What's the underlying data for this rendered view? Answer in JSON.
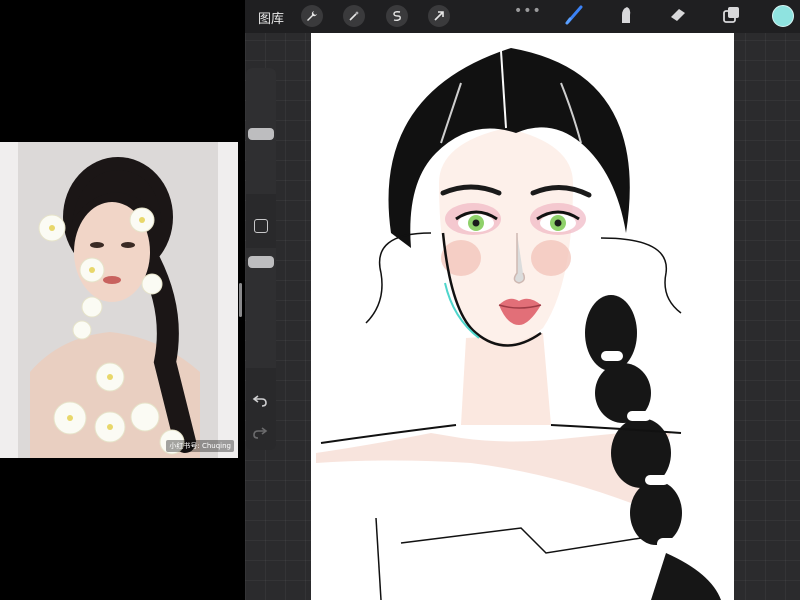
{
  "toolbar": {
    "gallery_label": "图库",
    "more_label": "•••",
    "tools": [
      "wrench-icon",
      "magic-wand-icon",
      "selection-icon",
      "transform-arrow-icon"
    ],
    "right_tools": [
      "brush-icon",
      "smudge-icon",
      "eraser-icon",
      "layers-icon"
    ],
    "active_color": "#8fe3e0"
  },
  "reference": {
    "watermark": "小红书号: Chuqing"
  },
  "colors": {
    "accent_brush": "#3b82f6",
    "workspace_bg": "#2b2b2d"
  }
}
